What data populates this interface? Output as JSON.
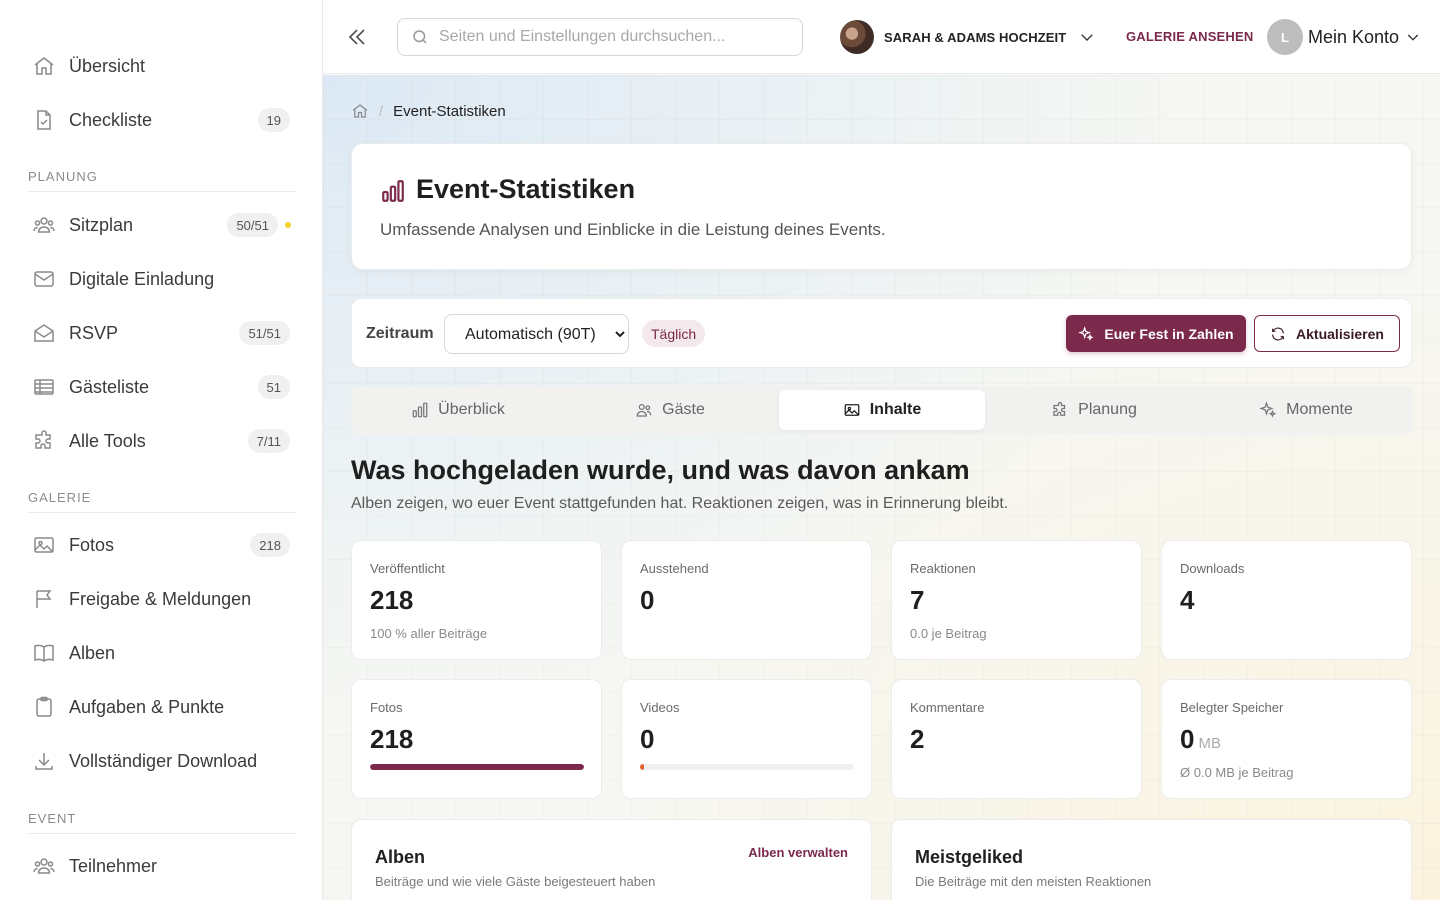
{
  "sidebar": {
    "top_items": [
      {
        "label": "Übersicht",
        "icon": "home-icon"
      },
      {
        "label": "Checkliste",
        "icon": "checklist-icon",
        "badge": "19"
      }
    ],
    "sections": [
      {
        "title": "PLANUNG",
        "items": [
          {
            "label": "Sitzplan",
            "icon": "users-icon",
            "badge": "50/51",
            "dot_color": "#f5d12b"
          },
          {
            "label": "Digitale Einladung",
            "icon": "mail-icon"
          },
          {
            "label": "RSVP",
            "icon": "mail-open-icon",
            "badge": "51/51"
          },
          {
            "label": "Gästeliste",
            "icon": "table-icon",
            "badge": "51"
          },
          {
            "label": "Alle Tools",
            "icon": "puzzle-icon",
            "badge": "7/11"
          }
        ]
      },
      {
        "title": "GALERIE",
        "items": [
          {
            "label": "Fotos",
            "icon": "image-icon",
            "badge": "218"
          },
          {
            "label": "Freigabe & Meldungen",
            "icon": "flag-icon"
          },
          {
            "label": "Alben",
            "icon": "book-icon"
          },
          {
            "label": "Aufgaben & Punkte",
            "icon": "clipboard-icon"
          },
          {
            "label": "Vollständiger Download",
            "icon": "download-icon"
          }
        ]
      },
      {
        "title": "EVENT",
        "items": [
          {
            "label": "Teilnehmer",
            "icon": "users-icon"
          }
        ]
      }
    ]
  },
  "topbar": {
    "search_placeholder": "Seiten und Einstellungen durchsuchen...",
    "event_name": "SARAH & ADAMS HOCHZEIT",
    "gallery_link": "GALERIE ANSEHEN",
    "account_initial": "L",
    "account_label": "Mein Konto"
  },
  "breadcrumb": {
    "current": "Event-Statistiken"
  },
  "header": {
    "title": "Event-Statistiken",
    "subtitle": "Umfassende Analysen und Einblicke in die Leistung deines Events."
  },
  "filters": {
    "period_label": "Zeitraum",
    "period_value": "Automatisch (90T)",
    "frequency": "Täglich",
    "primary_button": "Euer Fest in Zahlen",
    "refresh_button": "Aktualisieren"
  },
  "tabs": [
    {
      "label": "Überblick",
      "icon": "bar-chart-icon",
      "active": false
    },
    {
      "label": "Gäste",
      "icon": "users-icon",
      "active": false
    },
    {
      "label": "Inhalte",
      "icon": "image-icon",
      "active": true
    },
    {
      "label": "Planung",
      "icon": "puzzle-icon",
      "active": false
    },
    {
      "label": "Momente",
      "icon": "sparkles-icon",
      "active": false
    }
  ],
  "content": {
    "title": "Was hochgeladen wurde, und was davon ankam",
    "subtitle": "Alben zeigen, wo euer Event stattgefunden hat. Reaktionen zeigen, was in Erinnerung bleibt."
  },
  "stats": [
    {
      "label": "Veröffentlicht",
      "value": "218",
      "sub": "100 % aller Beiträge"
    },
    {
      "label": "Ausstehend",
      "value": "0"
    },
    {
      "label": "Reaktionen",
      "value": "7",
      "sub": "0.0 je Beitrag"
    },
    {
      "label": "Downloads",
      "value": "4"
    },
    {
      "label": "Fotos",
      "value": "218",
      "progress": 1.0,
      "bar_color": "#7b2a4b"
    },
    {
      "label": "Videos",
      "value": "0",
      "progress": 0.0,
      "bar_color": "#e0632e"
    },
    {
      "label": "Kommentare",
      "value": "2"
    },
    {
      "label": "Belegter Speicher",
      "value": "0",
      "unit": "MB",
      "sub": "Ø 0.0 MB je Beitrag"
    }
  ],
  "panels": {
    "albums": {
      "title": "Alben",
      "subtitle": "Beiträge und wie viele Gäste beigesteuert haben",
      "link": "Alben verwalten"
    },
    "top_liked": {
      "title": "Meistgeliked",
      "subtitle": "Die Beiträge mit den meisten Reaktionen"
    }
  },
  "colors": {
    "accent": "#7b2a4b"
  }
}
